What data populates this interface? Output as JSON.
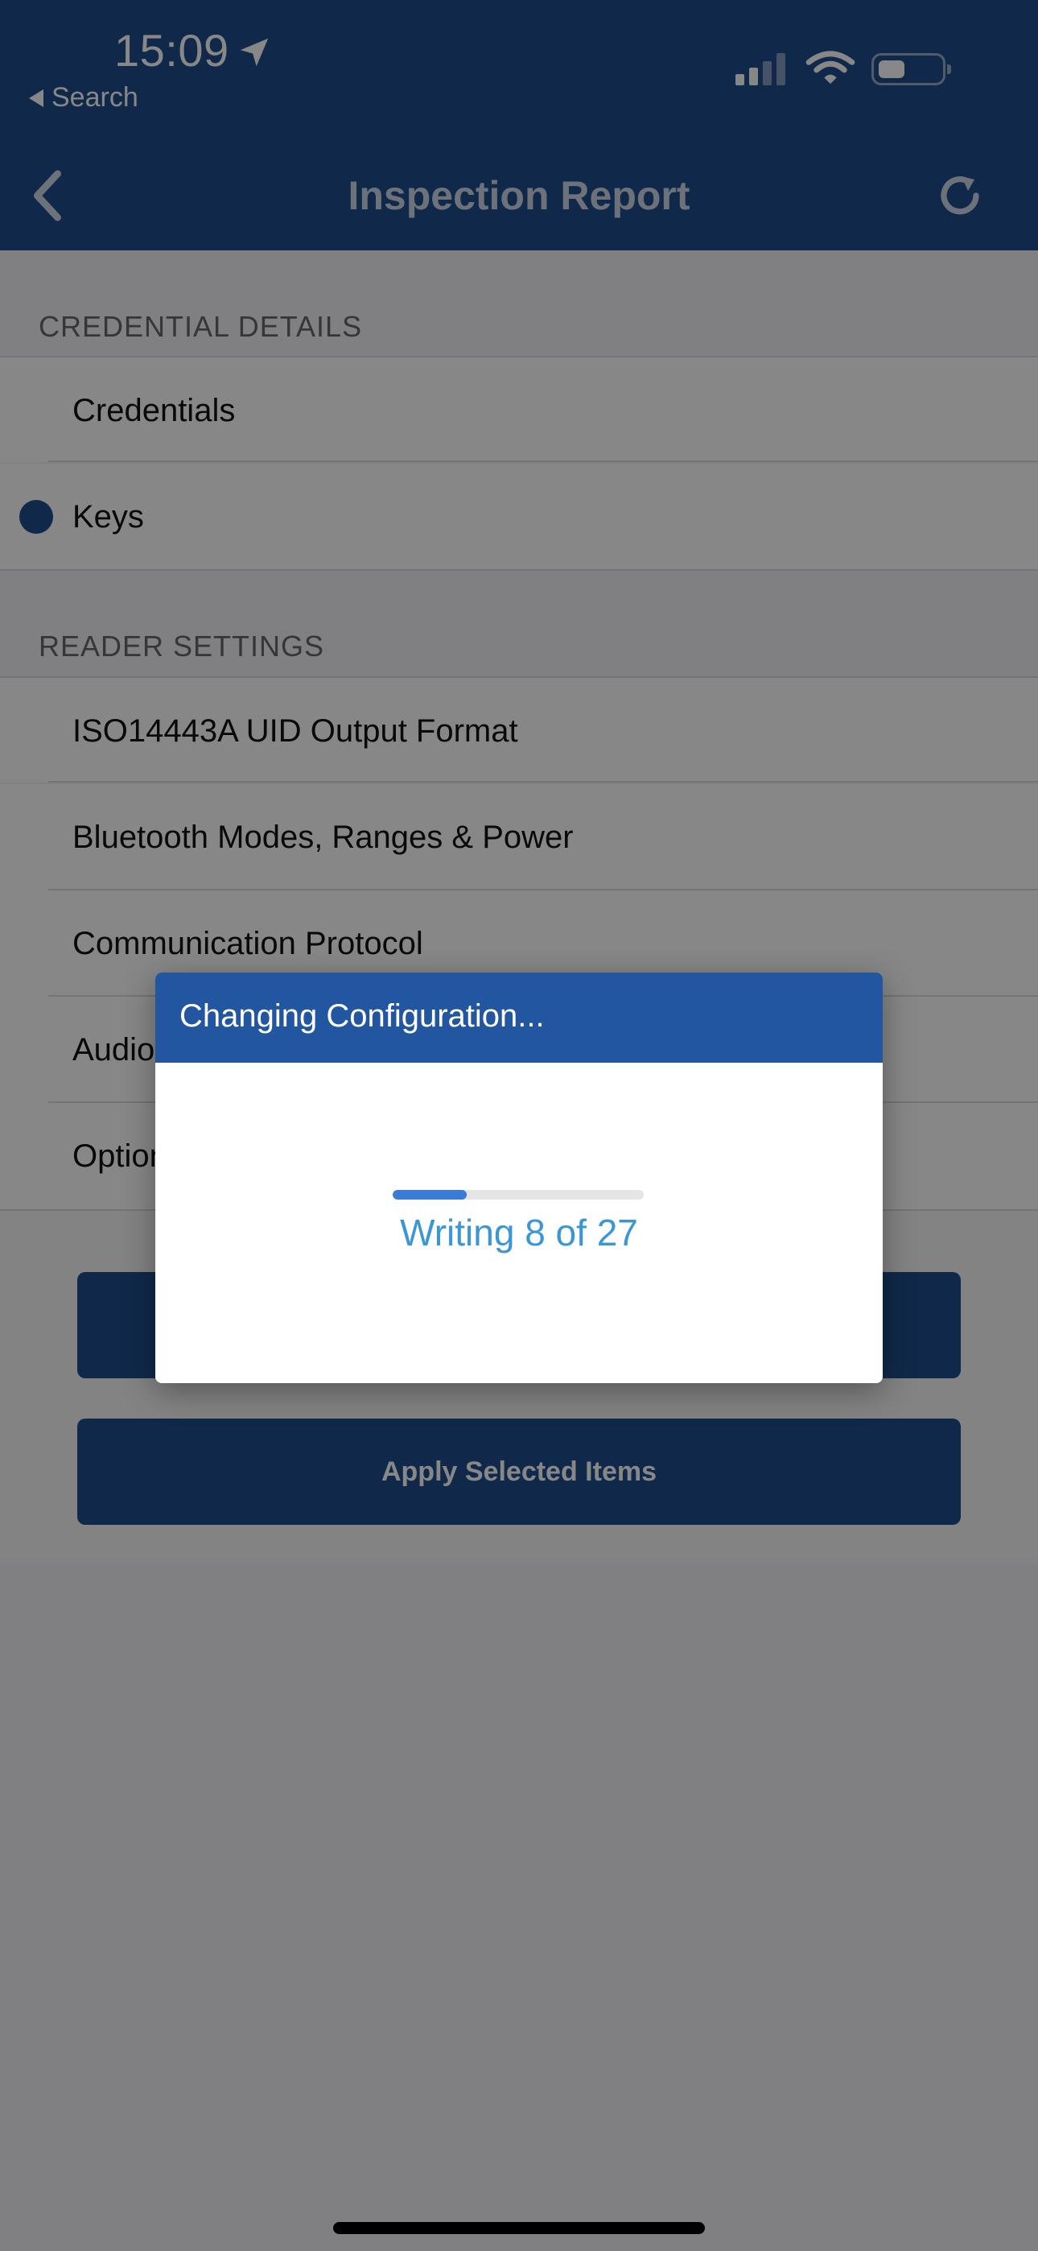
{
  "status_bar": {
    "time": "15:09",
    "back_app_label": "Search"
  },
  "nav": {
    "title": "Inspection Report"
  },
  "sections": [
    {
      "header": "CREDENTIAL DETAILS",
      "items": [
        {
          "label": "Credentials",
          "selected": false
        },
        {
          "label": "Keys",
          "selected": true
        }
      ]
    },
    {
      "header": "READER SETTINGS",
      "items": [
        {
          "label": "ISO14443A UID Output Format"
        },
        {
          "label": "Bluetooth Modes, Ranges & Power"
        },
        {
          "label": "Communication Protocol"
        },
        {
          "label": "Audio"
        },
        {
          "label": "Options"
        }
      ]
    }
  ],
  "buttons": {
    "primary_label": "",
    "apply_label": "Apply Selected Items"
  },
  "modal": {
    "title": "Changing Configuration...",
    "progress_text": "Writing 8 of 27",
    "progress_current": 8,
    "progress_total": 27
  },
  "colors": {
    "brand": "#1f4e8c",
    "modal_header": "#2356a0",
    "progress_fill": "#3a7bd5",
    "progress_text": "#3a96d4"
  },
  "icons": [
    "location-arrow-icon",
    "signal-icon",
    "wifi-icon",
    "battery-icon",
    "chevron-left-icon",
    "refresh-icon"
  ]
}
